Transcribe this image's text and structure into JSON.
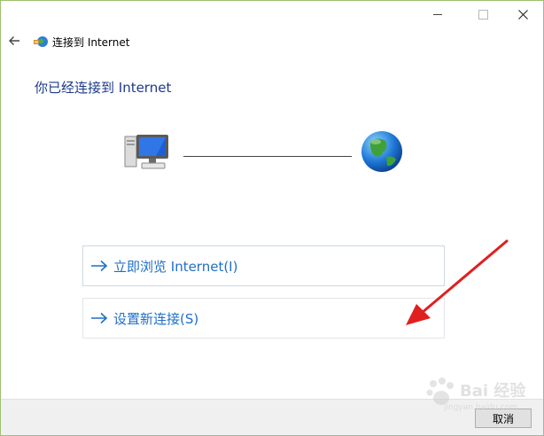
{
  "window": {
    "nav_title": "连接到 Internet",
    "controls": {
      "minimize": "minimize-icon",
      "maximize": "maximize-icon",
      "close": "close-icon"
    }
  },
  "main": {
    "title": "你已经连接到 Internet",
    "diagram": {
      "left_icon": "computer-icon",
      "right_icon": "globe-icon"
    }
  },
  "options": [
    {
      "label": "立即浏览 Internet(I)",
      "icon": "arrow-right-icon"
    },
    {
      "label": "设置新连接(S)",
      "icon": "arrow-right-icon"
    }
  ],
  "footer": {
    "cancel_label": "取消"
  },
  "watermark": {
    "text": "Bai 经验",
    "url": "jingyan.baidu.com"
  },
  "colors": {
    "title": "#1d3a8a",
    "link": "#1e6fc8",
    "annotation_arrow": "#e0201f",
    "window_border": "#9fbf6e"
  }
}
